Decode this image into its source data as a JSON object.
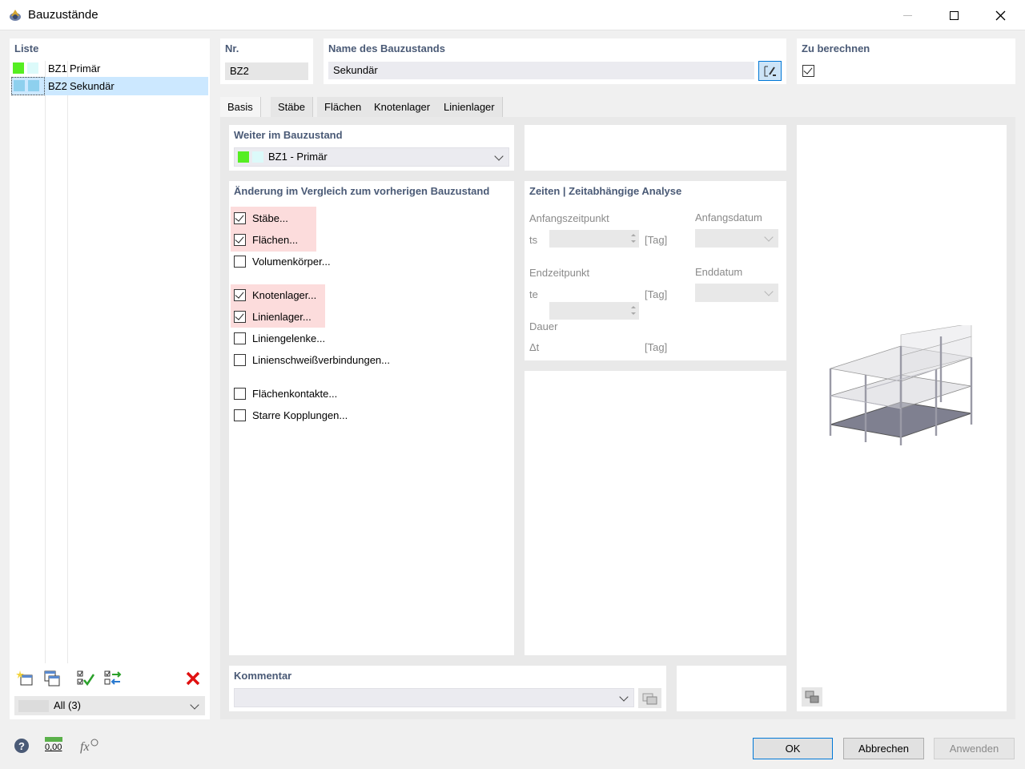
{
  "window": {
    "title": "Bauzustände"
  },
  "list": {
    "heading": "Liste",
    "items": [
      {
        "code": "BZ1",
        "name": "Primär",
        "color1": "#55ee22",
        "color2": "#dcfafa"
      },
      {
        "code": "BZ2",
        "name": "Sekundär",
        "color1": "#8ed0ee",
        "color2": "#8ed0ee",
        "selected": true
      }
    ],
    "filter": "All (3)"
  },
  "nr": {
    "heading": "Nr.",
    "value": "BZ2"
  },
  "name": {
    "heading": "Name des Bauzustands",
    "value": "Sekundär"
  },
  "calc": {
    "heading": "Zu berechnen",
    "checked": true
  },
  "tabs": [
    "Basis",
    "Stäbe",
    "Flächen",
    "Knotenlager",
    "Linienlager"
  ],
  "weiter": {
    "heading": "Weiter im Bauzustand",
    "value": "BZ1 - Primär"
  },
  "changes": {
    "heading": "Änderung im Vergleich zum vorherigen Bauzustand",
    "items": [
      {
        "label": "Stäbe...",
        "checked": true
      },
      {
        "label": "Flächen...",
        "checked": true
      },
      {
        "label": "Volumenkörper...",
        "checked": false
      },
      {
        "label": "Knotenlager...",
        "checked": true
      },
      {
        "label": "Linienlager...",
        "checked": true
      },
      {
        "label": "Liniengelenke...",
        "checked": false
      },
      {
        "label": "Linienschweißverbindungen...",
        "checked": false
      },
      {
        "label": "Flächenkontakte...",
        "checked": false
      },
      {
        "label": "Starre Kopplungen...",
        "checked": false
      }
    ]
  },
  "times": {
    "heading": "Zeiten | Zeitabhängige Analyse",
    "start_label": "Anfangszeitpunkt",
    "start_sym": "ts",
    "start_unit": "[Tag]",
    "start_date_label": "Anfangsdatum",
    "end_label": "Endzeitpunkt",
    "end_sym": "te",
    "end_unit": "[Tag]",
    "end_date_label": "Enddatum",
    "dur_label": "Dauer",
    "dur_sym": "Δt",
    "dur_unit": "[Tag]"
  },
  "comment": {
    "heading": "Kommentar",
    "value": ""
  },
  "buttons": {
    "ok": "OK",
    "cancel": "Abbrechen",
    "apply": "Anwenden"
  },
  "footer": {
    "units_label": "0,00"
  },
  "colors": {
    "accent": "#0078d7",
    "heading": "#4a5a76",
    "highlight": "#fcdcdc",
    "selection": "#cce8ff"
  }
}
